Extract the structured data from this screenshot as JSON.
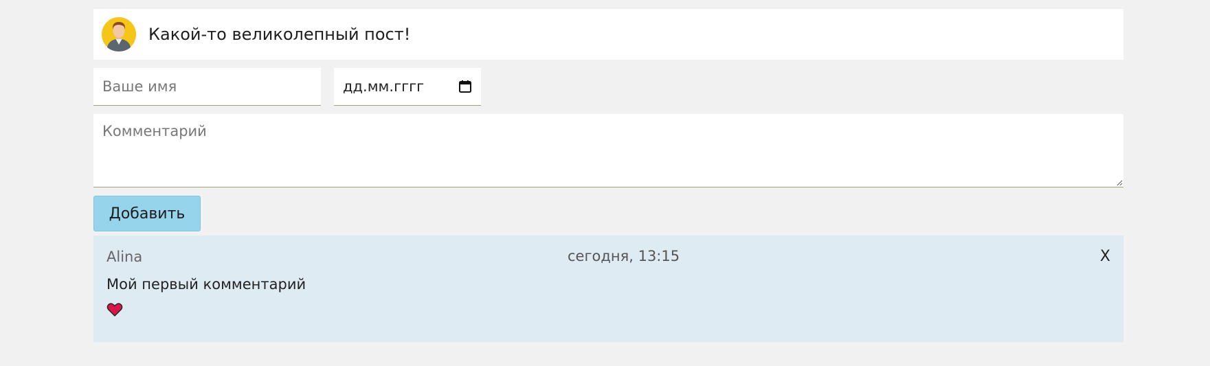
{
  "post": {
    "title": "Какой-то великолепный пост!",
    "avatar_icon": "user-avatar-icon"
  },
  "form": {
    "name_placeholder": "Ваше имя",
    "date_placeholder": "дд.мм.гггг",
    "comment_placeholder": "Комментарий",
    "submit_label": "Добавить"
  },
  "comments": [
    {
      "author": "Alina",
      "date": "сегодня, 13:15",
      "text": "Мой первый комментарий",
      "delete_label": "X",
      "liked": true
    }
  ],
  "colors": {
    "page_bg": "#f1f1f1",
    "button_bg": "#96d4ec",
    "comment_bg": "#dfebf2",
    "heart": "#d6174a",
    "avatar_bg": "#f5c518"
  }
}
